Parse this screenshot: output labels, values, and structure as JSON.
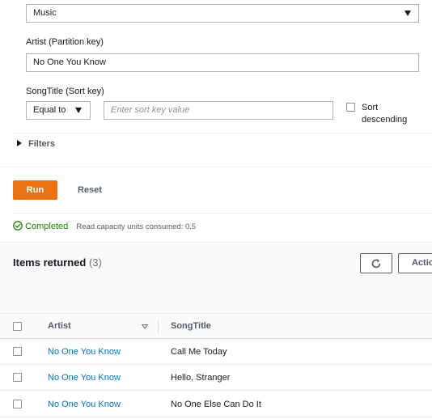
{
  "query": {
    "table_select": {
      "value": "Music"
    },
    "partition_key": {
      "label": "Artist (Partition key)",
      "value": "No One You Know"
    },
    "sort_key": {
      "label": "SongTitle (Sort key)",
      "condition": "Equal to",
      "placeholder": "Enter sort key value",
      "descending_label_line1": "Sort",
      "descending_label_line2": "descending"
    },
    "filters_label": "Filters"
  },
  "actions": {
    "run_label": "Run",
    "reset_label": "Reset"
  },
  "status": {
    "state": "Completed",
    "message": "Read capacity units consumed: 0.5"
  },
  "results": {
    "title": "Items returned",
    "count": "(3)",
    "actions_label": "Actions",
    "columns": [
      "Artist",
      "SongTitle"
    ],
    "rows": [
      {
        "artist": "No One You Know",
        "song": "Call Me Today"
      },
      {
        "artist": "No One You Know",
        "song": "Hello, Stranger"
      },
      {
        "artist": "No One You Know",
        "song": "No One Else Can Do It"
      }
    ]
  },
  "colors": {
    "primary": "#ec7211",
    "link": "#0073bb",
    "success": "#1d8102"
  }
}
